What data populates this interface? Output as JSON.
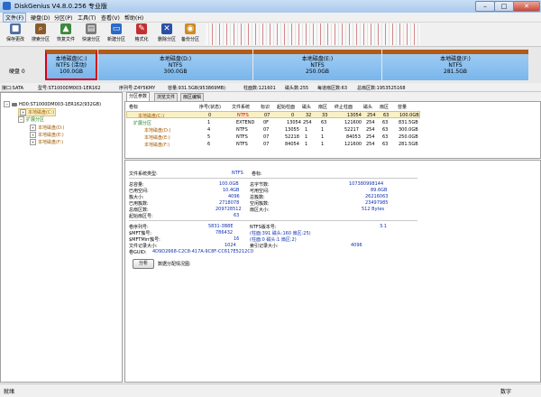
{
  "window": {
    "title": "DiskGenius V4.8.0.256 专业版",
    "minimize": "–",
    "maximize": "□",
    "close": "✕"
  },
  "menu": [
    "文件(F)",
    "硬盘(D)",
    "分区(P)",
    "工具(T)",
    "查看(V)",
    "帮助(H)"
  ],
  "toolbar": [
    {
      "label": "保存更改",
      "icon": "save-icon",
      "color": "#4f6f9f"
    },
    {
      "label": "搜索分区",
      "icon": "search-icon",
      "color": "#8a5a2b"
    },
    {
      "label": "恢复文件",
      "icon": "recover-icon",
      "color": "#3b8a3b"
    },
    {
      "label": "快速分区",
      "icon": "quick-partition-icon",
      "color": "#7a7a7a"
    },
    {
      "label": "新建分区",
      "icon": "new-partition-icon",
      "color": "#2b6ac7"
    },
    {
      "label": "格式化",
      "icon": "format-icon",
      "color": "#c23030"
    },
    {
      "label": "删除分区",
      "icon": "delete-partition-icon",
      "color": "#2b4fa8"
    },
    {
      "label": "备份分区",
      "icon": "backup-icon",
      "color": "#d08a20"
    }
  ],
  "diskmap": {
    "label": "硬盘 0",
    "partitions": [
      {
        "name": "本地磁盘(C:)",
        "fs": "NTFS (活动)",
        "size": "100.0GB",
        "selected": true
      },
      {
        "name": "本地磁盘(D:)",
        "fs": "NTFS",
        "size": "300.0GB",
        "selected": false
      },
      {
        "name": "本地磁盘(E:)",
        "fs": "NTFS",
        "size": "250.0GB",
        "selected": false
      },
      {
        "name": "本地磁盘(F:)",
        "fs": "NTFS",
        "size": "281.5GB",
        "selected": false
      }
    ]
  },
  "infoline": {
    "interface": "接口:SATA",
    "model": "型号:ST1000DM003-1ER162",
    "serial": "序列号:Z4Y5KMY",
    "capacity": "容量:931.5GB(953869MB)",
    "cylinders": "柱面数:121601",
    "heads": "磁头数:255",
    "sectors_per_track": "每道扇区数:63",
    "total_sectors": "总扇区数:1953525168"
  },
  "tree": {
    "disk": "HD0:ST1000DM003-1ER162(932GB)",
    "c": "本地磁盘(C:)",
    "ext": "扩展分区",
    "d": "本地磁盘(D:)",
    "e": "本地磁盘(E:)",
    "f": "本地磁盘(F:)"
  },
  "tabs": [
    "分区参数",
    "浏览文件",
    "扇区编辑"
  ],
  "ptable": {
    "headers": [
      "卷标",
      "序号(状态)",
      "文件系统",
      "标识",
      "起始柱面",
      "磁头",
      "扇区",
      "终止柱面",
      "磁头",
      "扇区",
      "容量"
    ],
    "rows": [
      [
        "本地磁盘(C:)",
        "0",
        "NTFS",
        "07",
        "0",
        "32",
        "33",
        "13054",
        "254",
        "63",
        "100.0GB"
      ],
      [
        "扩展分区",
        "1",
        "EXTEND",
        "0F",
        "13054",
        "254",
        "63",
        "121600",
        "254",
        "63",
        "831.5GB"
      ],
      [
        "本地磁盘(D:)",
        "4",
        "NTFS",
        "07",
        "13055",
        "1",
        "1",
        "52217",
        "254",
        "63",
        "300.0GB"
      ],
      [
        "本地磁盘(E:)",
        "5",
        "NTFS",
        "07",
        "52218",
        "1",
        "1",
        "84053",
        "254",
        "63",
        "250.0GB"
      ],
      [
        "本地磁盘(F:)",
        "6",
        "NTFS",
        "07",
        "84054",
        "1",
        "1",
        "121600",
        "254",
        "63",
        "281.5GB"
      ]
    ]
  },
  "details": {
    "fs_type_label": "文件系统类型:",
    "fs_type": "NTFS",
    "vol_label": "卷标:",
    "left": [
      [
        "总容量:",
        "100.0GB"
      ],
      [
        "已用空间:",
        "10.4GB"
      ],
      [
        "簇大小:",
        "4096"
      ],
      [
        "已用簇数:",
        "2718078"
      ],
      [
        "总扇区数:",
        "209728512"
      ],
      [
        "起始扇区号:",
        "63"
      ]
    ],
    "right": [
      [
        "总字节数:",
        "107380998144"
      ],
      [
        "可用空间:",
        "89.6GB"
      ],
      [
        "总簇数:",
        "26216063"
      ],
      [
        "空闲簇数:",
        "23497985"
      ],
      [
        "扇区大小:",
        "512 Bytes"
      ]
    ],
    "left2": [
      [
        "卷序列号:",
        "5831-3B8E"
      ],
      [
        "$MFT簇号:",
        "786432"
      ],
      [
        "$MFTMirr簇号:",
        "16"
      ],
      [
        "文件记录大小:",
        "1024"
      ],
      [
        "卷GUID:",
        "4D9D2668-C2C8-417A-9C8F-CC617E5212C0"
      ]
    ],
    "right2": [
      [
        "NTFS版本号:",
        "3.1"
      ],
      [
        "(柱面:391 磁头:160 扇区:25)",
        ""
      ],
      [
        "(柱面:0 磁头:1 扇区:2)",
        ""
      ],
      [
        "索引记录大小:",
        "4096"
      ]
    ],
    "analyze_button": "分析",
    "analyze_text": "数据分配情况图:"
  },
  "status": {
    "left": "就绪",
    "right": "数字"
  }
}
